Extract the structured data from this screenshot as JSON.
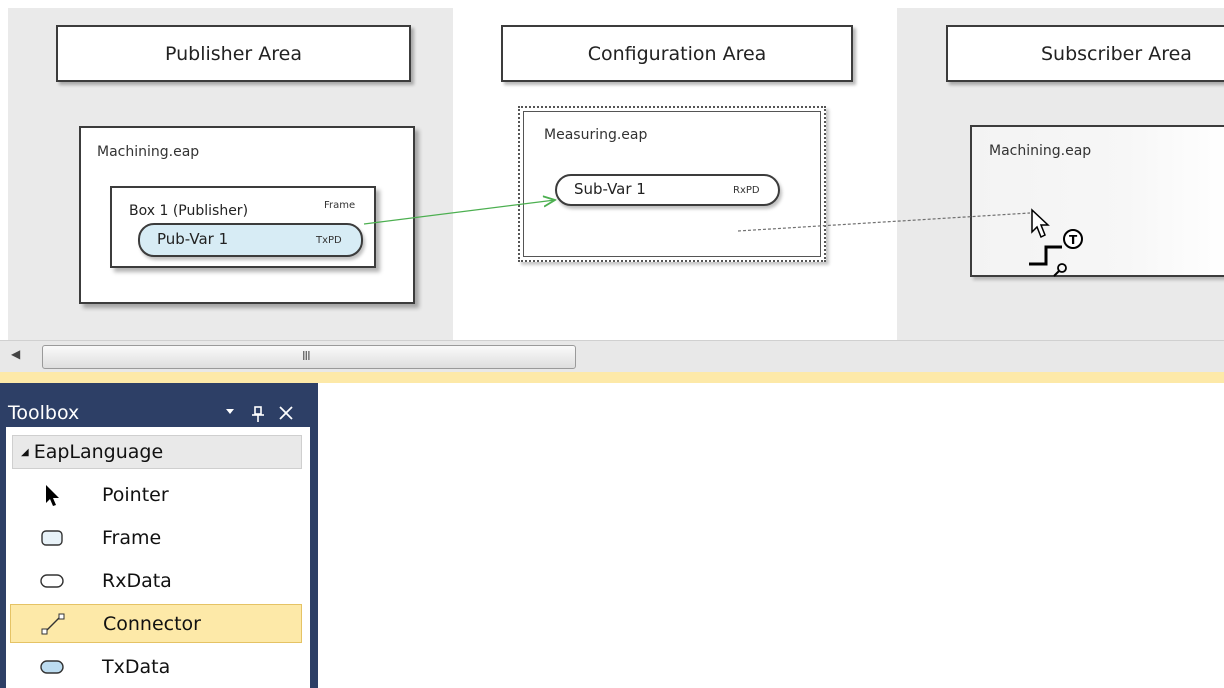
{
  "canvas": {
    "areas": {
      "publisher": "Publisher Area",
      "configuration": "Configuration Area",
      "subscriber": "Subscriber Area"
    },
    "publisher_frame": {
      "title": "Machining.eap",
      "box": {
        "title": "Box 1 (Publisher)",
        "tag": "Frame",
        "pill_label": "Pub-Var 1",
        "pill_tag": "TxPD"
      }
    },
    "configuration_frame": {
      "title": "Measuring.eap",
      "pill_label": "Sub-Var 1",
      "pill_tag": "RxPD"
    },
    "subscriber_frame": {
      "title": "Machining.eap"
    }
  },
  "scrollbar": {
    "left_arrow": "◀",
    "grip": "III"
  },
  "toolbox": {
    "title": "Toolbox",
    "group": "EapLanguage",
    "group_toggle": "◢",
    "items": [
      {
        "label": "Pointer",
        "icon": "pointer-icon"
      },
      {
        "label": "Frame",
        "icon": "frame-icon"
      },
      {
        "label": "RxData",
        "icon": "rxdata-icon"
      },
      {
        "label": "Connector",
        "icon": "connector-icon",
        "selected": true
      },
      {
        "label": "TxData",
        "icon": "txdata-icon"
      }
    ],
    "colors": {
      "panel": "#2d3f66",
      "selection": "#fde9a8"
    }
  }
}
